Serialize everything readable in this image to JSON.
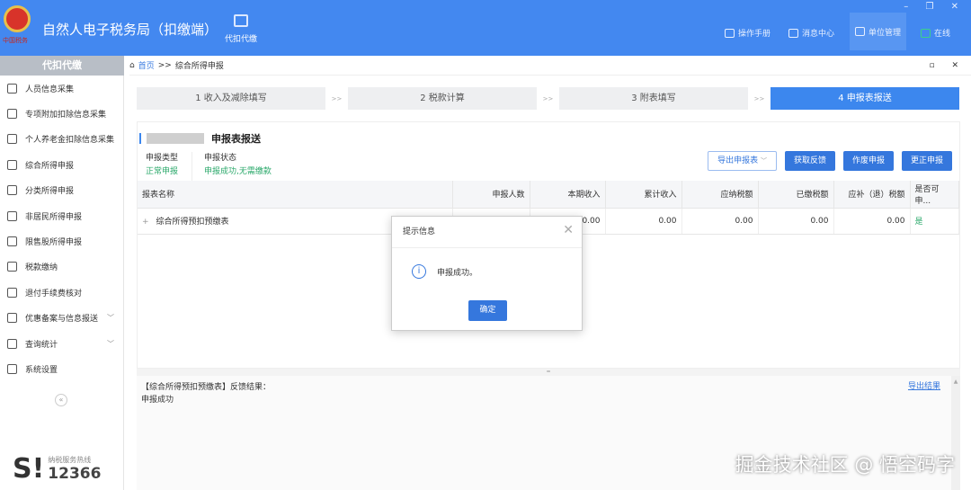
{
  "header": {
    "logo_text": "中国税务",
    "title": "自然人电子税务局（扣缴端）",
    "module": "代扣代缴",
    "nav": [
      "操作手册",
      "消息中心",
      "单位管理",
      "在线"
    ],
    "window_controls": "– ❐ ✕"
  },
  "sidebar": {
    "tab": "代扣代缴",
    "items": [
      {
        "label": "人员信息采集"
      },
      {
        "label": "专项附加扣除信息采集"
      },
      {
        "label": "个人养老金扣除信息采集"
      },
      {
        "label": "综合所得申报"
      },
      {
        "label": "分类所得申报"
      },
      {
        "label": "非居民所得申报"
      },
      {
        "label": "限售股所得申报"
      },
      {
        "label": "税款缴纳"
      },
      {
        "label": "退付手续费核对"
      },
      {
        "label": "优惠备案与信息报送",
        "chevron": "﹀"
      },
      {
        "label": "查询统计",
        "chevron": "﹀"
      },
      {
        "label": "系统设置"
      }
    ],
    "collapse": "«",
    "hotline_label": "纳税服务热线",
    "hotline_number": "12366"
  },
  "breadcrumb": {
    "home": "首页",
    "sep": ">>",
    "current": "综合所得申报",
    "controls": "▫ ✕"
  },
  "steps": [
    "1 收入及减除填写",
    "2 税款计算",
    "3 附表填写",
    "4 申报表报送"
  ],
  "step_sep": ">>",
  "section": {
    "title": "申报表报送",
    "type_label": "申报类型",
    "type_value": "正常申报",
    "status_label": "申报状态",
    "status_value": "申报成功,无需缴款"
  },
  "buttons": {
    "export": "导出申报表",
    "export_chev": "﹀",
    "feedback": "获取反馈",
    "void": "作废申报",
    "correct": "更正申报"
  },
  "table": {
    "headers": [
      "报表名称",
      "申报人数",
      "本期收入",
      "累计收入",
      "应纳税额",
      "已缴税额",
      "应补（退）税额",
      "是否可申..."
    ],
    "rows": [
      {
        "expand": "+",
        "name": "综合所得预扣预缴表",
        "count": "",
        "income": "0.00",
        "cum_income": "0.00",
        "tax_payable": "0.00",
        "tax_paid": "0.00",
        "tax_due": "0.00",
        "can": "是"
      }
    ]
  },
  "feedback": {
    "line1": "【综合所得预扣预缴表】反馈结果：",
    "line2": "申报成功",
    "export_link": "导出结果"
  },
  "dialog": {
    "title": "提示信息",
    "close": "✕",
    "icon": "i",
    "message": "申报成功。",
    "ok": "确定"
  },
  "watermark": "掘金技术社区 @ 悟空码字"
}
